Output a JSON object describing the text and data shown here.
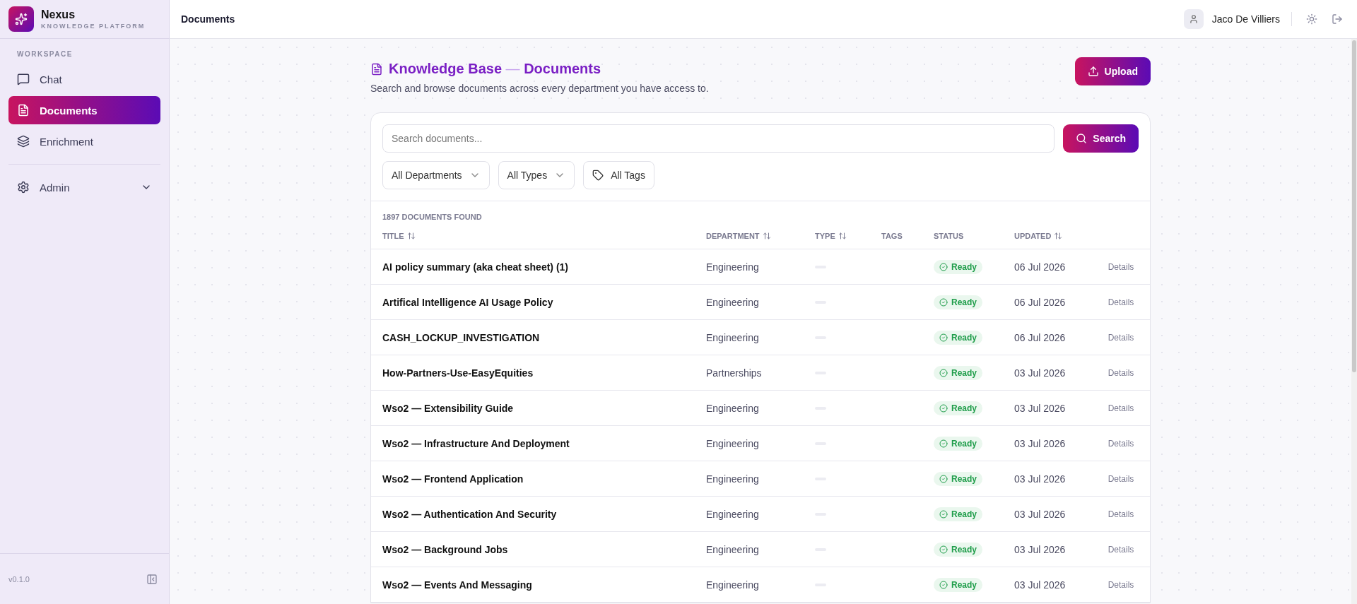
{
  "brand": {
    "name": "Nexus",
    "tagline": "KNOWLEDGE PLATFORM"
  },
  "sidebar": {
    "section": "WORKSPACE",
    "items": [
      {
        "kind": "chat",
        "label": "Chat",
        "selected": false
      },
      {
        "kind": "documents",
        "label": "Documents",
        "selected": true
      },
      {
        "kind": "enrichment",
        "label": "Enrichment",
        "selected": false
      }
    ],
    "admin": {
      "label": "Admin",
      "expanded": false
    },
    "version": "v0.1.0"
  },
  "header": {
    "title": "Documents",
    "user": "Jaco De Villiers"
  },
  "page": {
    "title_part_1": "Knowledge Base",
    "title_separator": "—",
    "title_part_2": "Documents",
    "subtitle": "Search and browse documents across every department you have access to.",
    "upload_button": "Upload"
  },
  "search": {
    "placeholder": "Search documents...",
    "button": "Search"
  },
  "filters": [
    {
      "kind": "dropdown",
      "label": "All Departments"
    },
    {
      "kind": "dropdown",
      "label": "All Types"
    },
    {
      "kind": "tags",
      "label": "All Tags"
    }
  ],
  "table": {
    "count": "1897 DOCUMENTS FOUND",
    "columns": [
      {
        "label": "TITLE",
        "sortable": true
      },
      {
        "label": "DEPARTMENT",
        "sortable": true
      },
      {
        "label": "TYPE",
        "sortable": true
      },
      {
        "label": "TAGS",
        "sortable": false
      },
      {
        "label": "STATUS",
        "sortable": false
      },
      {
        "label": "UPDATED",
        "sortable": true
      }
    ],
    "rows": [
      {
        "title": "AI policy summary (aka cheat sheet) (1)",
        "department": "Engineering",
        "status": "Ready",
        "updated": "06 Jul 2026",
        "action": "Details"
      },
      {
        "title": "Artifical Intelligence AI Usage Policy",
        "department": "Engineering",
        "status": "Ready",
        "updated": "06 Jul 2026",
        "action": "Details"
      },
      {
        "title": "CASH_LOCKUP_INVESTIGATION",
        "department": "Engineering",
        "status": "Ready",
        "updated": "06 Jul 2026",
        "action": "Details"
      },
      {
        "title": "How-Partners-Use-EasyEquities",
        "department": "Partnerships",
        "status": "Ready",
        "updated": "03 Jul 2026",
        "action": "Details"
      },
      {
        "title": "Wso2 — Extensibility Guide",
        "department": "Engineering",
        "status": "Ready",
        "updated": "03 Jul 2026",
        "action": "Details"
      },
      {
        "title": "Wso2 — Infrastructure And Deployment",
        "department": "Engineering",
        "status": "Ready",
        "updated": "03 Jul 2026",
        "action": "Details"
      },
      {
        "title": "Wso2 — Frontend Application",
        "department": "Engineering",
        "status": "Ready",
        "updated": "03 Jul 2026",
        "action": "Details"
      },
      {
        "title": "Wso2 — Authentication And Security",
        "department": "Engineering",
        "status": "Ready",
        "updated": "03 Jul 2026",
        "action": "Details"
      },
      {
        "title": "Wso2 — Background Jobs",
        "department": "Engineering",
        "status": "Ready",
        "updated": "03 Jul 2026",
        "action": "Details"
      },
      {
        "title": "Wso2 — Events And Messaging",
        "department": "Engineering",
        "status": "Ready",
        "updated": "03 Jul 2026",
        "action": "Details"
      }
    ]
  }
}
